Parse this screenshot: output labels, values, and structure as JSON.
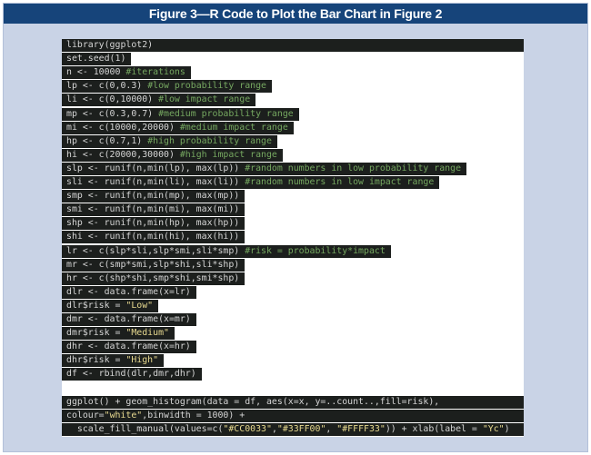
{
  "figure": {
    "title": "Figure 3—R Code to Plot the Bar Chart in Figure 2"
  },
  "code_lines": [
    {
      "segments": [
        {
          "t": "library(ggplot2)",
          "k": "code"
        }
      ]
    },
    {
      "segments": [
        {
          "t": "set.seed(1)",
          "k": "code"
        }
      ]
    },
    {
      "segments": [
        {
          "t": "n <- 10000 ",
          "k": "code"
        },
        {
          "t": "#iterations",
          "k": "comment"
        }
      ]
    },
    {
      "segments": [
        {
          "t": "lp <- c(0,0.3) ",
          "k": "code"
        },
        {
          "t": "#low probability range",
          "k": "comment"
        }
      ]
    },
    {
      "segments": [
        {
          "t": "li <- c(0,10000) ",
          "k": "code"
        },
        {
          "t": "#low impact range",
          "k": "comment"
        }
      ]
    },
    {
      "segments": [
        {
          "t": "mp <- c(0.3,0.7) ",
          "k": "code"
        },
        {
          "t": "#medium probability range",
          "k": "comment"
        }
      ]
    },
    {
      "segments": [
        {
          "t": "mi <- c(10000,20000) ",
          "k": "code"
        },
        {
          "t": "#medium impact range",
          "k": "comment"
        }
      ]
    },
    {
      "segments": [
        {
          "t": "hp <- c(0.7,1) ",
          "k": "code"
        },
        {
          "t": "#high probability range",
          "k": "comment"
        }
      ]
    },
    {
      "segments": [
        {
          "t": "hi <- c(20000,30000) ",
          "k": "code"
        },
        {
          "t": "#high impact range",
          "k": "comment"
        }
      ]
    },
    {
      "segments": [
        {
          "t": "slp <- runif(n,min(lp), max(lp)) ",
          "k": "code"
        },
        {
          "t": "#random numbers in low probability range",
          "k": "comment"
        }
      ]
    },
    {
      "segments": [
        {
          "t": "sli <- runif(n,min(li), max(li)) ",
          "k": "code"
        },
        {
          "t": "#random numbers in low impact range",
          "k": "comment"
        }
      ]
    },
    {
      "segments": [
        {
          "t": "smp <- runif(n,min(mp), max(mp))",
          "k": "code"
        }
      ]
    },
    {
      "segments": [
        {
          "t": "smi <- runif(n,min(mi), max(mi))",
          "k": "code"
        }
      ]
    },
    {
      "segments": [
        {
          "t": "shp <- runif(n,min(hp), max(hp))",
          "k": "code"
        }
      ]
    },
    {
      "segments": [
        {
          "t": "shi <- runif(n,min(hi), max(hi))",
          "k": "code"
        }
      ]
    },
    {
      "segments": [
        {
          "t": "lr <- c(slp*sli,slp*smi,sli*smp) ",
          "k": "code"
        },
        {
          "t": "#risk = probability*impact",
          "k": "comment"
        }
      ]
    },
    {
      "segments": [
        {
          "t": "mr <- c(smp*smi,slp*shi,sli*shp)",
          "k": "code"
        }
      ]
    },
    {
      "segments": [
        {
          "t": "hr <- c(shp*shi,smp*shi,smi*shp)",
          "k": "code"
        }
      ]
    },
    {
      "segments": [
        {
          "t": "dlr <- data.frame(x=lr)",
          "k": "code"
        }
      ]
    },
    {
      "segments": [
        {
          "t": "dlr$risk = ",
          "k": "code"
        },
        {
          "t": "\"Low\"",
          "k": "string"
        }
      ]
    },
    {
      "segments": [
        {
          "t": "dmr <- data.frame(x=mr)",
          "k": "code"
        }
      ]
    },
    {
      "segments": [
        {
          "t": "dmr$risk = ",
          "k": "code"
        },
        {
          "t": "\"Medium\"",
          "k": "string"
        }
      ]
    },
    {
      "segments": [
        {
          "t": "dhr <- data.frame(x=hr)",
          "k": "code"
        }
      ]
    },
    {
      "segments": [
        {
          "t": "dhr$risk = ",
          "k": "code"
        },
        {
          "t": "\"High\"",
          "k": "string"
        }
      ]
    },
    {
      "segments": [
        {
          "t": "df <- rbind(dlr,dmr,dhr)",
          "k": "code"
        }
      ]
    },
    {
      "segments": []
    },
    {
      "segments": [
        {
          "t": "ggplot() + geom_histogram(data = df, aes(x=x, y=..count..,fill=risk),",
          "k": "code"
        }
      ]
    },
    {
      "segments": [
        {
          "t": "colour=",
          "k": "code"
        },
        {
          "t": "\"white\"",
          "k": "string"
        },
        {
          "t": ",binwidth = 1000) +",
          "k": "code"
        }
      ]
    },
    {
      "segments": [
        {
          "t": "  scale_fill_manual(values=c(",
          "k": "code"
        },
        {
          "t": "\"#CC0033\"",
          "k": "string"
        },
        {
          "t": ",",
          "k": "code"
        },
        {
          "t": "\"#33FF00\"",
          "k": "string"
        },
        {
          "t": ", ",
          "k": "code"
        },
        {
          "t": "\"#FFFF33\"",
          "k": "string"
        },
        {
          "t": ")) + xlab(label = ",
          "k": "code"
        },
        {
          "t": "\"Yc\"",
          "k": "string"
        },
        {
          "t": ")",
          "k": "code"
        }
      ]
    }
  ],
  "colors": {
    "frame_bg": "#c9d3e6",
    "title_bg": "#16447a",
    "code_bg": "#1c1f1d",
    "code_text": "#d5d5d5",
    "comment": "#75a760",
    "string": "#e7d98f"
  }
}
